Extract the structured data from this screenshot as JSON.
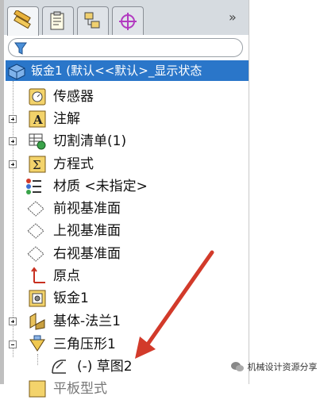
{
  "tabs": [
    {
      "name": "feature-manager",
      "icon": "feature-manager-icon",
      "active": true
    },
    {
      "name": "property-manager",
      "icon": "property-manager-icon",
      "active": false
    },
    {
      "name": "configuration-manager",
      "icon": "configuration-manager-icon",
      "active": false
    },
    {
      "name": "dimxpert-manager",
      "icon": "crosshair-icon",
      "active": false
    }
  ],
  "overflow_label": "»",
  "root": {
    "label": "钣金1  (默认<<默认>_显示状态",
    "icon": "part-icon"
  },
  "tree": [
    {
      "label": "传感器",
      "icon": "sensor-icon",
      "expander": ""
    },
    {
      "label": "注解",
      "icon": "annotation-icon",
      "expander": "plus"
    },
    {
      "label": "切割清单(1)",
      "icon": "cut-list-icon",
      "expander": "plus"
    },
    {
      "label": "方程式",
      "icon": "equation-icon",
      "expander": "plus"
    },
    {
      "label": "材质 <未指定>",
      "icon": "material-icon",
      "expander": ""
    },
    {
      "label": "前视基准面",
      "icon": "plane-icon",
      "expander": ""
    },
    {
      "label": "上视基准面",
      "icon": "plane-icon",
      "expander": ""
    },
    {
      "label": "右视基准面",
      "icon": "plane-icon",
      "expander": ""
    },
    {
      "label": "原点",
      "icon": "origin-icon",
      "expander": ""
    },
    {
      "label": "钣金1",
      "icon": "sheet-metal-icon",
      "expander": ""
    },
    {
      "label": "基体-法兰1",
      "icon": "base-flange-icon",
      "expander": "plus"
    },
    {
      "label": "三角压形1",
      "icon": "triangle-press-icon",
      "expander": "minus"
    },
    {
      "label": "(-) 草图2",
      "icon": "sketch-icon",
      "expander": "",
      "indent": true
    },
    {
      "label": "平板型式",
      "icon": "flat-pattern-icon",
      "expander": ""
    }
  ],
  "colors": {
    "selection": "#2a76c9",
    "arrow": "#d23a2a"
  },
  "watermark": "机械设计资源分享"
}
